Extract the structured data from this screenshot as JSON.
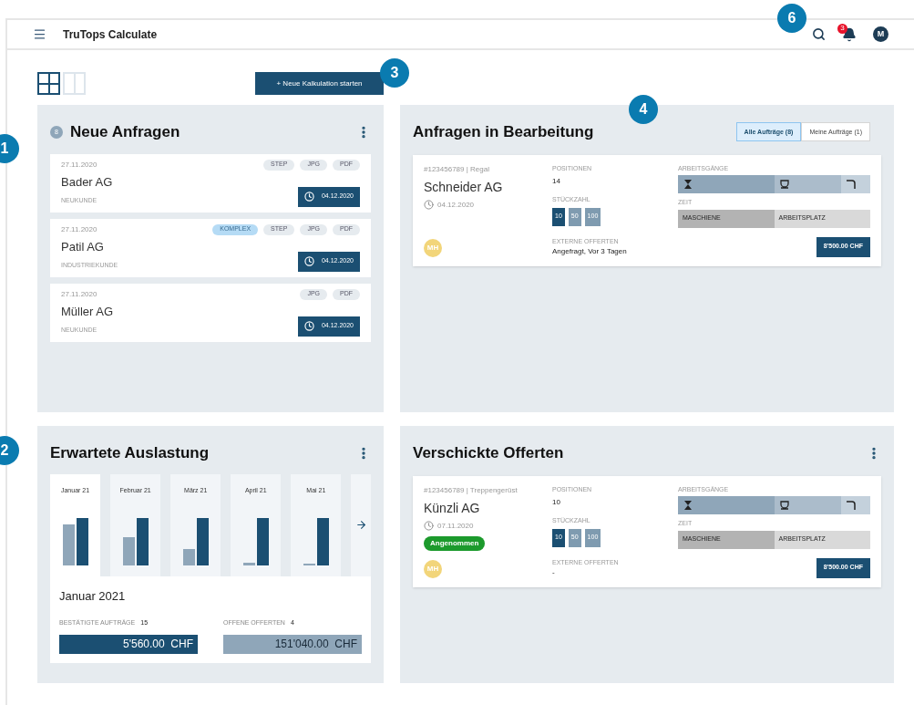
{
  "header": {
    "title": "TruTops Calculate",
    "notification_count": "3",
    "avatar": "M"
  },
  "view_toggle": [
    {
      "kind": "grid",
      "selected": true
    },
    {
      "kind": "columns",
      "selected": false
    }
  ],
  "new_button": "+ Neue Kalkulation starten",
  "markers": [
    {
      "label": "1"
    },
    {
      "label": "2"
    },
    {
      "label": "3"
    },
    {
      "label": "4"
    },
    {
      "label": "6"
    }
  ],
  "new_requests": {
    "title": "Neue Anfragen",
    "count": "8",
    "items": [
      {
        "date": "27.11.2020",
        "company": "Bader AG",
        "type": "NEUKUNDE",
        "due": "04.12.2020",
        "tags": [
          {
            "label": "STEP",
            "kind": "file"
          },
          {
            "label": "JPG",
            "kind": "file"
          },
          {
            "label": "PDF",
            "kind": "file"
          }
        ]
      },
      {
        "date": "27.11.2020",
        "company": "Patil AG",
        "type": "INDUSTRIEKUNDE",
        "due": "04.12.2020",
        "tags": [
          {
            "label": "KOMPLEX",
            "kind": "flag"
          },
          {
            "label": "STEP",
            "kind": "file"
          },
          {
            "label": "JPG",
            "kind": "file"
          },
          {
            "label": "PDF",
            "kind": "file"
          }
        ]
      },
      {
        "date": "27.11.2020",
        "company": "Müller AG",
        "type": "NEUKUNDE",
        "due": "04.12.2020",
        "tags": [
          {
            "label": "JPG",
            "kind": "file"
          },
          {
            "label": "PDF",
            "kind": "file"
          }
        ]
      }
    ]
  },
  "in_progress": {
    "title": "Anfragen in Bearbeitung",
    "filters": [
      {
        "label": "Alle Aufträge (8)",
        "selected": true
      },
      {
        "label": "Meine Aufträge (1)",
        "selected": false
      }
    ],
    "jobs": [
      {
        "ref": "#123456789 | Regal",
        "company": "Schneider AG",
        "date": "04.12.2020",
        "assignee": "MH",
        "positions_label": "POSITIONEN",
        "positions": "14",
        "quantity_label": "STÜCKZAHL",
        "quantities": [
          {
            "label": "10",
            "selected": true
          },
          {
            "label": "50",
            "selected": false
          },
          {
            "label": "100",
            "selected": false
          }
        ],
        "offers_label": "EXTERNE OFFERTEN",
        "offers": "Angefragt, Vor 3 Tagen",
        "operations_label": "ARBEITSGÄNGE",
        "time_label": "ZEIT",
        "time_parts": [
          "MASCHIENE",
          "ARBEITSPLATZ"
        ],
        "price": "8'500.00 CHF"
      }
    ]
  },
  "utilization": {
    "title": "Erwartete Auslastung",
    "months": [
      {
        "label": "Januar 21",
        "selected": true
      },
      {
        "label": "Februar 21",
        "selected": false
      },
      {
        "label": "März 21",
        "selected": false
      },
      {
        "label": "April 21",
        "selected": false
      },
      {
        "label": "Mai 21",
        "selected": false
      }
    ],
    "detail_title": "Januar 2021",
    "stats": [
      {
        "label": "BESTÄTIGTE AUFTRÄGE",
        "count": "15",
        "amount": "5'560.00  CHF",
        "kind": "confirmed"
      },
      {
        "label": "OFFENE OFFERTEN",
        "count": "4",
        "amount": "151'040.00  CHF",
        "kind": "open"
      }
    ]
  },
  "sent_offers": {
    "title": "Verschickte Offerten",
    "jobs": [
      {
        "ref": "#123456789 | Treppengerüst",
        "company": "Künzli AG",
        "date": "07.11.2020",
        "status": "Angenommen",
        "assignee": "MH",
        "positions_label": "POSITIONEN",
        "positions": "10",
        "quantity_label": "STÜCKZAHL",
        "quantities": [
          {
            "label": "10",
            "selected": true
          },
          {
            "label": "50",
            "selected": false
          },
          {
            "label": "100",
            "selected": false
          }
        ],
        "offers_label": "EXTERNE OFFERTEN",
        "offers": "-",
        "operations_label": "ARBEITSGÄNGE",
        "time_label": "ZEIT",
        "time_parts": [
          "MASCHIENE",
          "ARBEITSPLATZ"
        ],
        "price": "8'500.00 CHF"
      }
    ]
  }
}
